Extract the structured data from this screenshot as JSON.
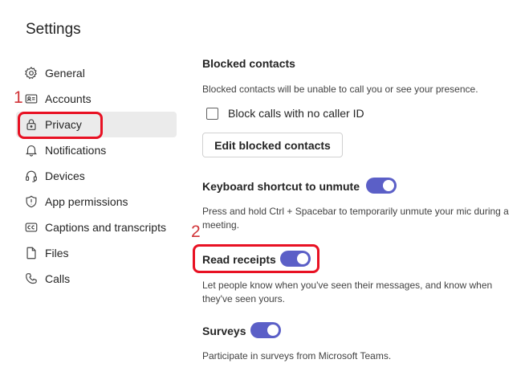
{
  "page": {
    "title": "Settings"
  },
  "sidebar": {
    "items": [
      {
        "label": "General",
        "icon": "gear-icon"
      },
      {
        "label": "Accounts",
        "icon": "id-card-icon"
      },
      {
        "label": "Privacy",
        "icon": "lock-icon",
        "active": true
      },
      {
        "label": "Notifications",
        "icon": "bell-icon"
      },
      {
        "label": "Devices",
        "icon": "headset-icon"
      },
      {
        "label": "App permissions",
        "icon": "shield-icon"
      },
      {
        "label": "Captions and transcripts",
        "icon": "cc-icon"
      },
      {
        "label": "Files",
        "icon": "file-icon"
      },
      {
        "label": "Calls",
        "icon": "phone-icon"
      }
    ]
  },
  "annotations": {
    "one": "1",
    "two": "2",
    "color": "#e81123"
  },
  "blocked": {
    "heading": "Blocked contacts",
    "description": "Blocked contacts will be unable to call you or see your presence.",
    "checkbox_label": "Block calls with no caller ID",
    "checkbox_checked": false,
    "button_label": "Edit blocked contacts"
  },
  "unmute": {
    "heading": "Keyboard shortcut to unmute",
    "enabled": true,
    "description": "Press and hold Ctrl + Spacebar to temporarily unmute your mic during a meeting."
  },
  "receipts": {
    "heading": "Read receipts",
    "enabled": true,
    "description": "Let people know when you've seen their messages, and know when they've seen yours."
  },
  "surveys": {
    "heading": "Surveys",
    "enabled": true,
    "description": "Participate in surveys from Microsoft Teams."
  },
  "colors": {
    "accent": "#5b5fc7"
  }
}
